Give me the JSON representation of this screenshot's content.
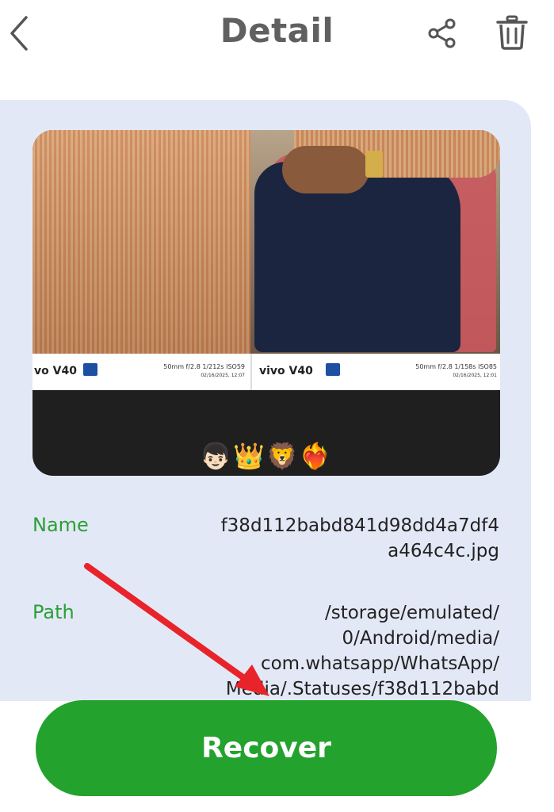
{
  "header": {
    "title": "Detail",
    "back_icon": "chevron-left-icon",
    "share_icon": "share-icon",
    "delete_icon": "trash-icon",
    "icon_color": "#555555"
  },
  "preview": {
    "left_caption_brand": "vo V40",
    "right_caption_brand": "vivo V40",
    "left_camera_spec": "50mm  f/2.8  1/212s  ISO59",
    "left_camera_date": "02/16/2025, 12:07",
    "right_camera_spec": "50mm  f/2.8  1/158s  ISO85",
    "right_camera_date": "02/16/2025, 12:01",
    "emojis": "👦🏻👑🦁❤️‍🔥"
  },
  "details": {
    "name_label": "Name",
    "name_value": "f38d112babd841d98dd4a7df4\na464c4c.jpg",
    "path_label": "Path",
    "path_value": "/storage/emulated/\n0/Android/media/\ncom.whatsapp/WhatsApp/\nMedia/.Statuses/f38d112babd"
  },
  "actions": {
    "recover_label": "Recover"
  },
  "colors": {
    "accent_green": "#23a22d",
    "label_green": "#2aa136",
    "card_bg": "#e3e8f6",
    "annotation_red": "#e8232a"
  }
}
